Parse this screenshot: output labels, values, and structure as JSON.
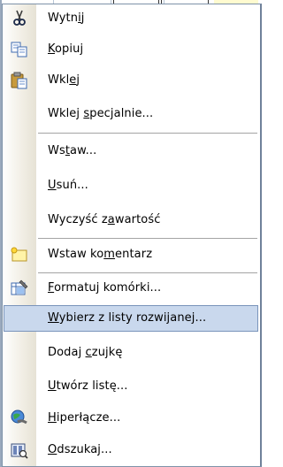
{
  "menu": {
    "items": [
      {
        "label": "Wytnij",
        "accel_index": 4,
        "icon": "scissors-icon"
      },
      {
        "label": "Kopiuj",
        "accel_index": 0,
        "icon": "copy-icon"
      },
      {
        "label": "Wklej",
        "accel_index": 3,
        "icon": "paste-icon"
      },
      {
        "label": "Wklej specjalnie...",
        "accel_index": 6,
        "icon": null
      },
      {
        "label": "Wstaw...",
        "accel_index": 2,
        "icon": null
      },
      {
        "label": "Usuń...",
        "accel_index": 0,
        "icon": null
      },
      {
        "label": "Wyczyść zawartość",
        "accel_index": 9,
        "icon": null
      },
      {
        "label": "Wstaw komentarz",
        "accel_index": 8,
        "icon": "comment-icon"
      },
      {
        "label": "Formatuj komórki...",
        "accel_index": 0,
        "icon": "format-cells-icon"
      },
      {
        "label": "Wybierz z listy rozwijanej...",
        "accel_index": 0,
        "icon": null,
        "highlighted": true
      },
      {
        "label": "Dodaj czujkę",
        "accel_index": 6,
        "icon": null
      },
      {
        "label": "Utwórz listę...",
        "accel_index": 0,
        "icon": null
      },
      {
        "label": "Hiperłącze...",
        "accel_index": 0,
        "icon": "hyperlink-icon"
      },
      {
        "label": "Odszukaj...",
        "accel_index": 0,
        "icon": "research-icon"
      }
    ]
  },
  "colors": {
    "highlight_bg": "#c9d8ed",
    "highlight_border": "#7a94bb",
    "separator": "#a4a4a4"
  }
}
